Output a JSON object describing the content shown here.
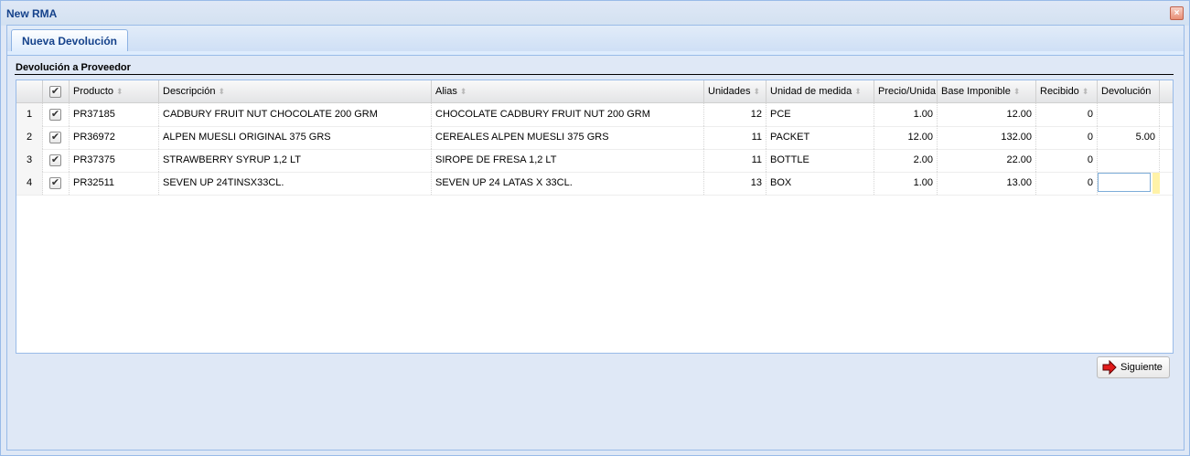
{
  "window": {
    "title": "New RMA",
    "close_icon": "close-icon"
  },
  "tabs": [
    {
      "label": "Nueva Devolución",
      "active": true
    }
  ],
  "fieldset": {
    "title": "Devolución a Proveedor"
  },
  "grid": {
    "columns": [
      {
        "key": "check",
        "label": "",
        "sortable": false
      },
      {
        "key": "producto",
        "label": "Producto",
        "sortable": true
      },
      {
        "key": "descripcion",
        "label": "Descripción",
        "sortable": true
      },
      {
        "key": "alias",
        "label": "Alias",
        "sortable": true
      },
      {
        "key": "unidades",
        "label": "Unidades",
        "sortable": true
      },
      {
        "key": "unidad_medida",
        "label": "Unidad de medida",
        "sortable": true
      },
      {
        "key": "precio",
        "label": "Precio/Unida",
        "sortable": false
      },
      {
        "key": "base",
        "label": "Base Imponible",
        "sortable": true
      },
      {
        "key": "recibido",
        "label": "Recibido",
        "sortable": true
      },
      {
        "key": "devolucion",
        "label": "Devolución",
        "sortable": false
      }
    ],
    "header_checked": true,
    "rows": [
      {
        "num": "1",
        "checked": true,
        "producto": "PR37185",
        "descripcion": "CADBURY FRUIT NUT CHOCOLATE 200 GRM",
        "alias": "CHOCOLATE CADBURY FRUIT NUT 200 GRM",
        "unidades": "12",
        "unidad_medida": "PCE",
        "precio": "1.00",
        "base": "12.00",
        "recibido": "0",
        "devolucion": ""
      },
      {
        "num": "2",
        "checked": true,
        "producto": "PR36972",
        "descripcion": "ALPEN MUESLI ORIGINAL 375 GRS",
        "alias": "CEREALES ALPEN MUESLI 375 GRS",
        "unidades": "11",
        "unidad_medida": "PACKET",
        "precio": "12.00",
        "base": "132.00",
        "recibido": "0",
        "devolucion": "5.00"
      },
      {
        "num": "3",
        "checked": true,
        "producto": "PR37375",
        "descripcion": "STRAWBERRY SYRUP 1,2 LT",
        "alias": "SIROPE DE FRESA 1,2 LT",
        "unidades": "11",
        "unidad_medida": "BOTTLE",
        "precio": "2.00",
        "base": "22.00",
        "recibido": "0",
        "devolucion": ""
      },
      {
        "num": "4",
        "checked": true,
        "producto": "PR32511",
        "descripcion": "SEVEN UP 24TINSX33CL.",
        "alias": "SEVEN UP 24 LATAS X 33CL.",
        "unidades": "13",
        "unidad_medida": "BOX",
        "precio": "1.00",
        "base": "13.00",
        "recibido": "0",
        "devolucion": "",
        "editing": "devolucion"
      }
    ]
  },
  "buttons": {
    "next": {
      "label": "Siguiente",
      "icon": "red-arrow-right-icon"
    }
  },
  "colors": {
    "title": "#15428b",
    "border": "#99bbe8",
    "panel_bg": "#dfe8f6"
  }
}
